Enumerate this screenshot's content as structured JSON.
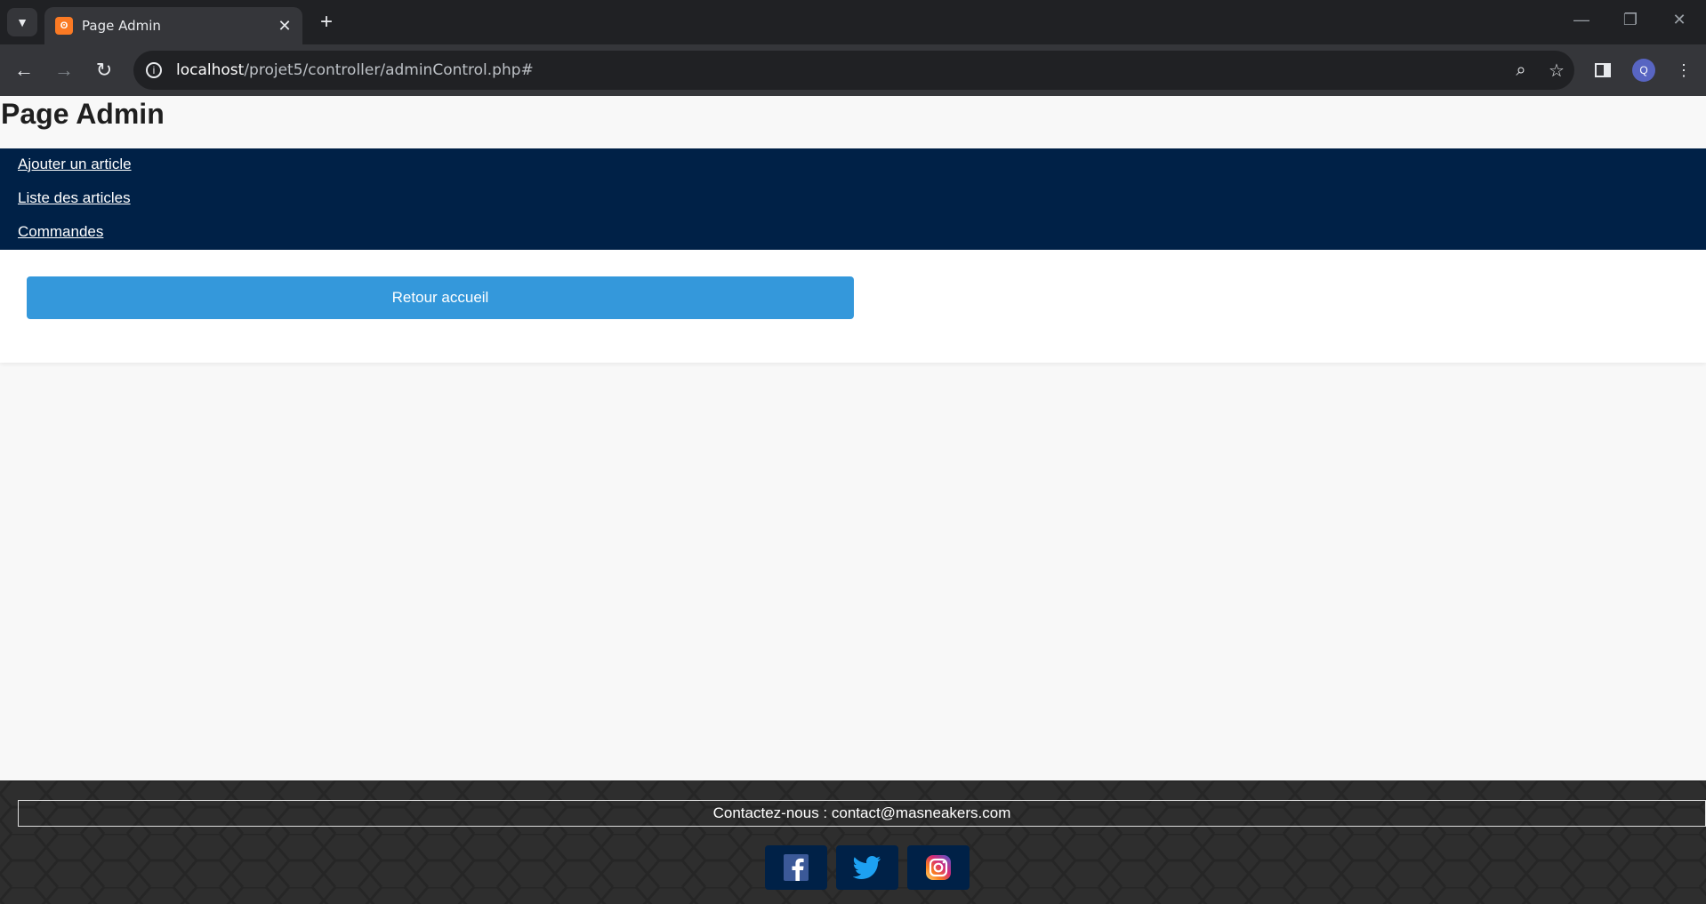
{
  "browser": {
    "tab_title": "Page Admin",
    "url_host": "localhost",
    "url_path": "/projet5/controller/adminControl.php#",
    "avatar_letter": "Q"
  },
  "page": {
    "title": "Page Admin"
  },
  "nav": {
    "items": [
      {
        "label": "Ajouter un article"
      },
      {
        "label": "Liste des articles"
      },
      {
        "label": "Commandes"
      }
    ]
  },
  "content": {
    "back_button_label": "Retour accueil"
  },
  "footer": {
    "contact_text": "Contactez-nous : contact@masneakers.com",
    "social": [
      "facebook-icon",
      "twitter-icon",
      "instagram-icon"
    ]
  },
  "colors": {
    "nav_bg": "#002147",
    "button_bg": "#3498db",
    "footer_bg": "#2e2e2e"
  }
}
